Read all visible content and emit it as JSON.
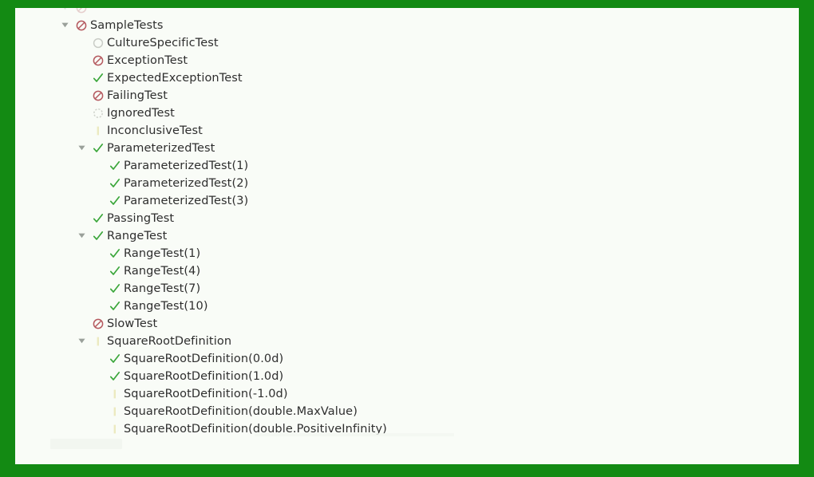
{
  "window": {
    "border_color": "#138a13",
    "content_background": "#f9fcf7",
    "text_color": "#2e2e2e"
  },
  "status_colors": {
    "failed": "#b5595f",
    "passed": "#3aa63a",
    "not_run": "#c9ccc6",
    "ignored": "#cfd2cb",
    "inconclusive": "#eceac0"
  },
  "tree": {
    "name": "test-explorer-tree",
    "rows": [
      {
        "label": "",
        "level": 1,
        "twisty": "chevron-down-icon",
        "icon": "test-failed-icon",
        "status": "failed",
        "clipped": true
      },
      {
        "label": "SampleTests",
        "level": 1,
        "twisty": "chevron-down-icon",
        "icon": "test-failed-icon",
        "status": "failed",
        "clipped": false
      },
      {
        "label": "CultureSpecificTest",
        "level": 2,
        "twisty": "",
        "icon": "test-not-run-icon",
        "status": "not_run",
        "clipped": false
      },
      {
        "label": "ExceptionTest",
        "level": 2,
        "twisty": "",
        "icon": "test-failed-icon",
        "status": "failed",
        "clipped": false
      },
      {
        "label": "ExpectedExceptionTest",
        "level": 2,
        "twisty": "",
        "icon": "test-passed-icon",
        "status": "passed",
        "clipped": false
      },
      {
        "label": "FailingTest",
        "level": 2,
        "twisty": "",
        "icon": "test-failed-icon",
        "status": "failed",
        "clipped": false
      },
      {
        "label": "IgnoredTest",
        "level": 2,
        "twisty": "",
        "icon": "test-ignored-icon",
        "status": "ignored",
        "clipped": false
      },
      {
        "label": "InconclusiveTest",
        "level": 2,
        "twisty": "",
        "icon": "test-inconclusive-icon",
        "status": "inconclusive",
        "clipped": false
      },
      {
        "label": "ParameterizedTest",
        "level": 2,
        "twisty": "chevron-down-icon",
        "icon": "test-passed-icon",
        "status": "passed",
        "clipped": false
      },
      {
        "label": "ParameterizedTest(1)",
        "level": 3,
        "twisty": "",
        "icon": "test-passed-icon",
        "status": "passed",
        "clipped": false
      },
      {
        "label": "ParameterizedTest(2)",
        "level": 3,
        "twisty": "",
        "icon": "test-passed-icon",
        "status": "passed",
        "clipped": false
      },
      {
        "label": "ParameterizedTest(3)",
        "level": 3,
        "twisty": "",
        "icon": "test-passed-icon",
        "status": "passed",
        "clipped": false
      },
      {
        "label": "PassingTest",
        "level": 2,
        "twisty": "",
        "icon": "test-passed-icon",
        "status": "passed",
        "clipped": false
      },
      {
        "label": "RangeTest",
        "level": 2,
        "twisty": "chevron-down-icon",
        "icon": "test-passed-icon",
        "status": "passed",
        "clipped": false
      },
      {
        "label": "RangeTest(1)",
        "level": 3,
        "twisty": "",
        "icon": "test-passed-icon",
        "status": "passed",
        "clipped": false
      },
      {
        "label": "RangeTest(4)",
        "level": 3,
        "twisty": "",
        "icon": "test-passed-icon",
        "status": "passed",
        "clipped": false
      },
      {
        "label": "RangeTest(7)",
        "level": 3,
        "twisty": "",
        "icon": "test-passed-icon",
        "status": "passed",
        "clipped": false
      },
      {
        "label": "RangeTest(10)",
        "level": 3,
        "twisty": "",
        "icon": "test-passed-icon",
        "status": "passed",
        "clipped": false
      },
      {
        "label": "SlowTest",
        "level": 2,
        "twisty": "",
        "icon": "test-failed-icon",
        "status": "failed",
        "clipped": false
      },
      {
        "label": "SquareRootDefinition",
        "level": 2,
        "twisty": "chevron-down-icon",
        "icon": "test-inconclusive-icon",
        "status": "inconclusive",
        "clipped": false
      },
      {
        "label": "SquareRootDefinition(0.0d)",
        "level": 3,
        "twisty": "",
        "icon": "test-passed-icon",
        "status": "passed",
        "clipped": false
      },
      {
        "label": "SquareRootDefinition(1.0d)",
        "level": 3,
        "twisty": "",
        "icon": "test-passed-icon",
        "status": "passed",
        "clipped": false
      },
      {
        "label": "SquareRootDefinition(-1.0d)",
        "level": 3,
        "twisty": "",
        "icon": "test-inconclusive-icon",
        "status": "inconclusive",
        "clipped": false
      },
      {
        "label": "SquareRootDefinition(double.MaxValue)",
        "level": 3,
        "twisty": "",
        "icon": "test-inconclusive-icon",
        "status": "inconclusive",
        "clipped": false
      },
      {
        "label": "SquareRootDefinition(double.PositiveInfinity)",
        "level": 3,
        "twisty": "",
        "icon": "test-inconclusive-icon",
        "status": "inconclusive",
        "clipped": false
      }
    ]
  }
}
